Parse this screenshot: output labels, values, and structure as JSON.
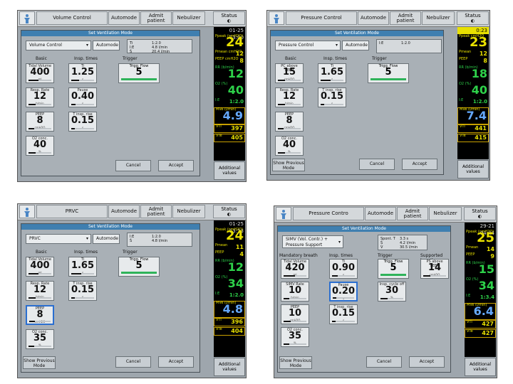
{
  "panels": [
    {
      "id": "p1",
      "mode_button": "Volume Control",
      "automode": "Automode",
      "admit": "Admit patient",
      "nebulizer": "Nebulizer",
      "status": "Status",
      "clock": "01-25  13:00",
      "dialog_title": "Set Ventilation Mode",
      "mode_select": "Volume Control",
      "automode_toggle": "Automode",
      "info": [
        "Ti",
        "I:E",
        "Ṡ",
        "1:2.0",
        "4.8 l/min",
        "20.4 l/min"
      ],
      "headers": [
        "Basic",
        "Insp. times",
        "Trigger"
      ],
      "knobs": [
        {
          "label": "Tidal Volume",
          "value": "400",
          "unit": "ml",
          "fill": 0.45
        },
        {
          "label": "Resp. Rate",
          "value": "12",
          "unit": "b/min",
          "fill": 0.3
        },
        {
          "label": "PEEP",
          "value": "8",
          "unit": "cmH2O",
          "fill": 0.25
        },
        {
          "label": "O2 conc.",
          "value": "40",
          "unit": "%",
          "fill": 0.3
        },
        {
          "label": "Ti",
          "value": "1.25",
          "unit": "s",
          "fill": 0.35
        },
        {
          "label": "Pause",
          "value": "0.40",
          "unit": "s",
          "fill": 0.2
        },
        {
          "label": "T insp. rise",
          "value": "0.15",
          "unit": "s",
          "fill": 0.15
        }
      ],
      "trigger": {
        "label": "Trigg. Flow",
        "value": "5"
      },
      "cancel": "Cancel",
      "accept": "Accept",
      "additional": "Additional values",
      "vitals": [
        {
          "label": "Ppeak (cmH2O)",
          "value": "24"
        },
        {
          "label": "Pmean cmH2O",
          "value": "12"
        },
        {
          "label": "PEEP cmH2O",
          "value": "8"
        },
        {
          "label": "RR (b/min)",
          "value": "12"
        },
        {
          "label": "O2 (%)",
          "value": "40"
        },
        {
          "label": "I:E",
          "value": "1:2.0"
        },
        {
          "label": "MVe (l/min)",
          "value": "4.9"
        },
        {
          "label": "VTi",
          "value": "397"
        },
        {
          "label": "VTe",
          "value": "405"
        }
      ]
    },
    {
      "id": "p2",
      "mode_button": "Pressure Control",
      "automode": "Automode",
      "admit": "Admit patient",
      "nebulizer": "Nebulizer",
      "status": "Status",
      "clock": "0:23",
      "dialog_title": "Set Ventilation Mode",
      "mode_select": "Pressure Control",
      "automode_toggle": "Automode",
      "info": [
        "I:E",
        "1:2.0"
      ],
      "headers": [
        "Basic",
        "Insp. times",
        "Trigger"
      ],
      "knobs": [
        {
          "label": "PC above PEEP",
          "value": "15",
          "unit": "cmH2O",
          "fill": 0.3
        },
        {
          "label": "Resp. Rate",
          "value": "12",
          "unit": "b/min",
          "fill": 0.3
        },
        {
          "label": "PEEP",
          "value": "8",
          "unit": "cmH2O",
          "fill": 0.25
        },
        {
          "label": "O2 conc.",
          "value": "40",
          "unit": "%",
          "fill": 0.3
        },
        {
          "label": "Ti",
          "value": "1.65",
          "unit": "s",
          "fill": 0.45
        },
        {
          "label": "T insp. rise",
          "value": "0.15",
          "unit": "s",
          "fill": 0.15
        }
      ],
      "trigger": {
        "label": "Trigg. Flow",
        "value": "5"
      },
      "show_previous": "Show Previous Mode",
      "cancel": "Cancel",
      "accept": "Accept",
      "additional": "Additional values",
      "vitals": [
        {
          "label": "Ppeak cmH2O",
          "value": "23"
        },
        {
          "label": "Pmean",
          "value": "12"
        },
        {
          "label": "PEEP",
          "value": "8"
        },
        {
          "label": "RR (b/min)",
          "value": "18"
        },
        {
          "label": "O2 (%)",
          "value": "40"
        },
        {
          "label": "I:E",
          "value": "1:2.0"
        },
        {
          "label": "MVe (l/min)",
          "value": "7.4"
        },
        {
          "label": "VTi",
          "value": "441"
        },
        {
          "label": "VTe",
          "value": "415"
        }
      ]
    },
    {
      "id": "p3",
      "mode_button": "PRVC",
      "automode": "Automode",
      "admit": "Admit patient",
      "nebulizer": "Nebulizer",
      "status": "Status",
      "clock": "01-25  13:13",
      "dialog_title": "Set Ventilation Mode",
      "mode_select": "PRVC",
      "automode_toggle": "Automode",
      "info": [
        "I:E",
        "Ṡ",
        "1:2.0",
        "4.8 l/min"
      ],
      "headers": [
        "Basic",
        "Insp. times",
        "Trigger"
      ],
      "knobs": [
        {
          "label": "Tidal Volume",
          "value": "400",
          "unit": "ml",
          "fill": 0.45
        },
        {
          "label": "Resp. Rate",
          "value": "12",
          "unit": "b/min",
          "fill": 0.3
        },
        {
          "label": "PEEP",
          "value": "8",
          "unit": "cmH2O",
          "fill": 0.25
        },
        {
          "label": "O2 conc.",
          "value": "35",
          "unit": "%",
          "fill": 0.25
        },
        {
          "label": "Ti",
          "value": "1.65",
          "unit": "s",
          "fill": 0.45
        },
        {
          "label": "T insp. rise",
          "value": "0.15",
          "unit": "s",
          "fill": 0.15
        }
      ],
      "trigger": {
        "label": "Trigg. Flow",
        "value": "5"
      },
      "show_previous": "Show Previous Mode",
      "cancel": "Cancel",
      "accept": "Accept",
      "additional": "Additional values",
      "vitals": [
        {
          "label": "Ppeak (cmH2O)",
          "value": "24"
        },
        {
          "label": "Pmean",
          "value": "11"
        },
        {
          "label": "PEEP",
          "value": "4"
        },
        {
          "label": "RR (b/min)",
          "value": "12"
        },
        {
          "label": "O2 (%)",
          "value": "34"
        },
        {
          "label": "I:E",
          "value": "1:2.0"
        },
        {
          "label": "MVe (l/min)",
          "value": "4.8"
        },
        {
          "label": "VTi",
          "value": "396"
        },
        {
          "label": "VTe",
          "value": "404"
        }
      ]
    },
    {
      "id": "p4",
      "mode_button": "Pressure Contro",
      "automode": "Automode",
      "admit": "Admit patient",
      "nebulizer": "Nebulizer",
      "status": "Status",
      "clock": "29-21  04:44",
      "dialog_title": "Set Ventilation Mode",
      "mode_select": "SIMV (Vol. Contr.) + Pressure Support",
      "info": [
        "Spont. T",
        "Ṡ",
        "V̇",
        "3.3 s",
        "4.2 l/min",
        "30.5 l/min"
      ],
      "headers": [
        "Mandatory breath",
        "Insp. times",
        "Trigger",
        "Supported breath"
      ],
      "knobs": [
        {
          "label": "Tidal Volume",
          "value": "420",
          "unit": "ml",
          "fill": 0.5
        },
        {
          "label": "SIMV Rate",
          "value": "10",
          "unit": "b/min",
          "fill": 0.25
        },
        {
          "label": "PEEP",
          "value": "10",
          "unit": "cmH2O",
          "fill": 0.3
        },
        {
          "label": "O2 conc.",
          "value": "35",
          "unit": "%",
          "fill": 0.25
        },
        {
          "label": "Ti",
          "value": "0.90",
          "unit": "s",
          "fill": 0.25
        },
        {
          "label": "Pause",
          "value": "0.20",
          "unit": "s",
          "fill": 0.15
        },
        {
          "label": "T insp. rise",
          "value": "0.15",
          "unit": "s",
          "fill": 0.15
        },
        {
          "label": "Insp. cycle off",
          "value": "30",
          "unit": "%",
          "fill": 0.3
        },
        {
          "label": "PS above PEEP",
          "value": "14",
          "unit": "cmH2O",
          "fill": 0.3
        }
      ],
      "trigger": {
        "label": "Trigg. Flow",
        "value": "5"
      },
      "show_previous": "Show Previous Mode",
      "cancel": "Cancel",
      "accept": "Accept",
      "additional": "Additional values",
      "vitals": [
        {
          "label": "Ppeak (cmH2O)",
          "value": "25"
        },
        {
          "label": "Pmean",
          "value": "14"
        },
        {
          "label": "PEEP",
          "value": "9"
        },
        {
          "label": "RR (b/min)",
          "value": "15"
        },
        {
          "label": "O2 (%)",
          "value": "34"
        },
        {
          "label": "I:E",
          "value": "1:3.4"
        },
        {
          "label": "MVe (l/min)",
          "value": "6.4"
        },
        {
          "label": "VTi",
          "value": "427"
        },
        {
          "label": "VTe",
          "value": "427"
        }
      ]
    }
  ]
}
